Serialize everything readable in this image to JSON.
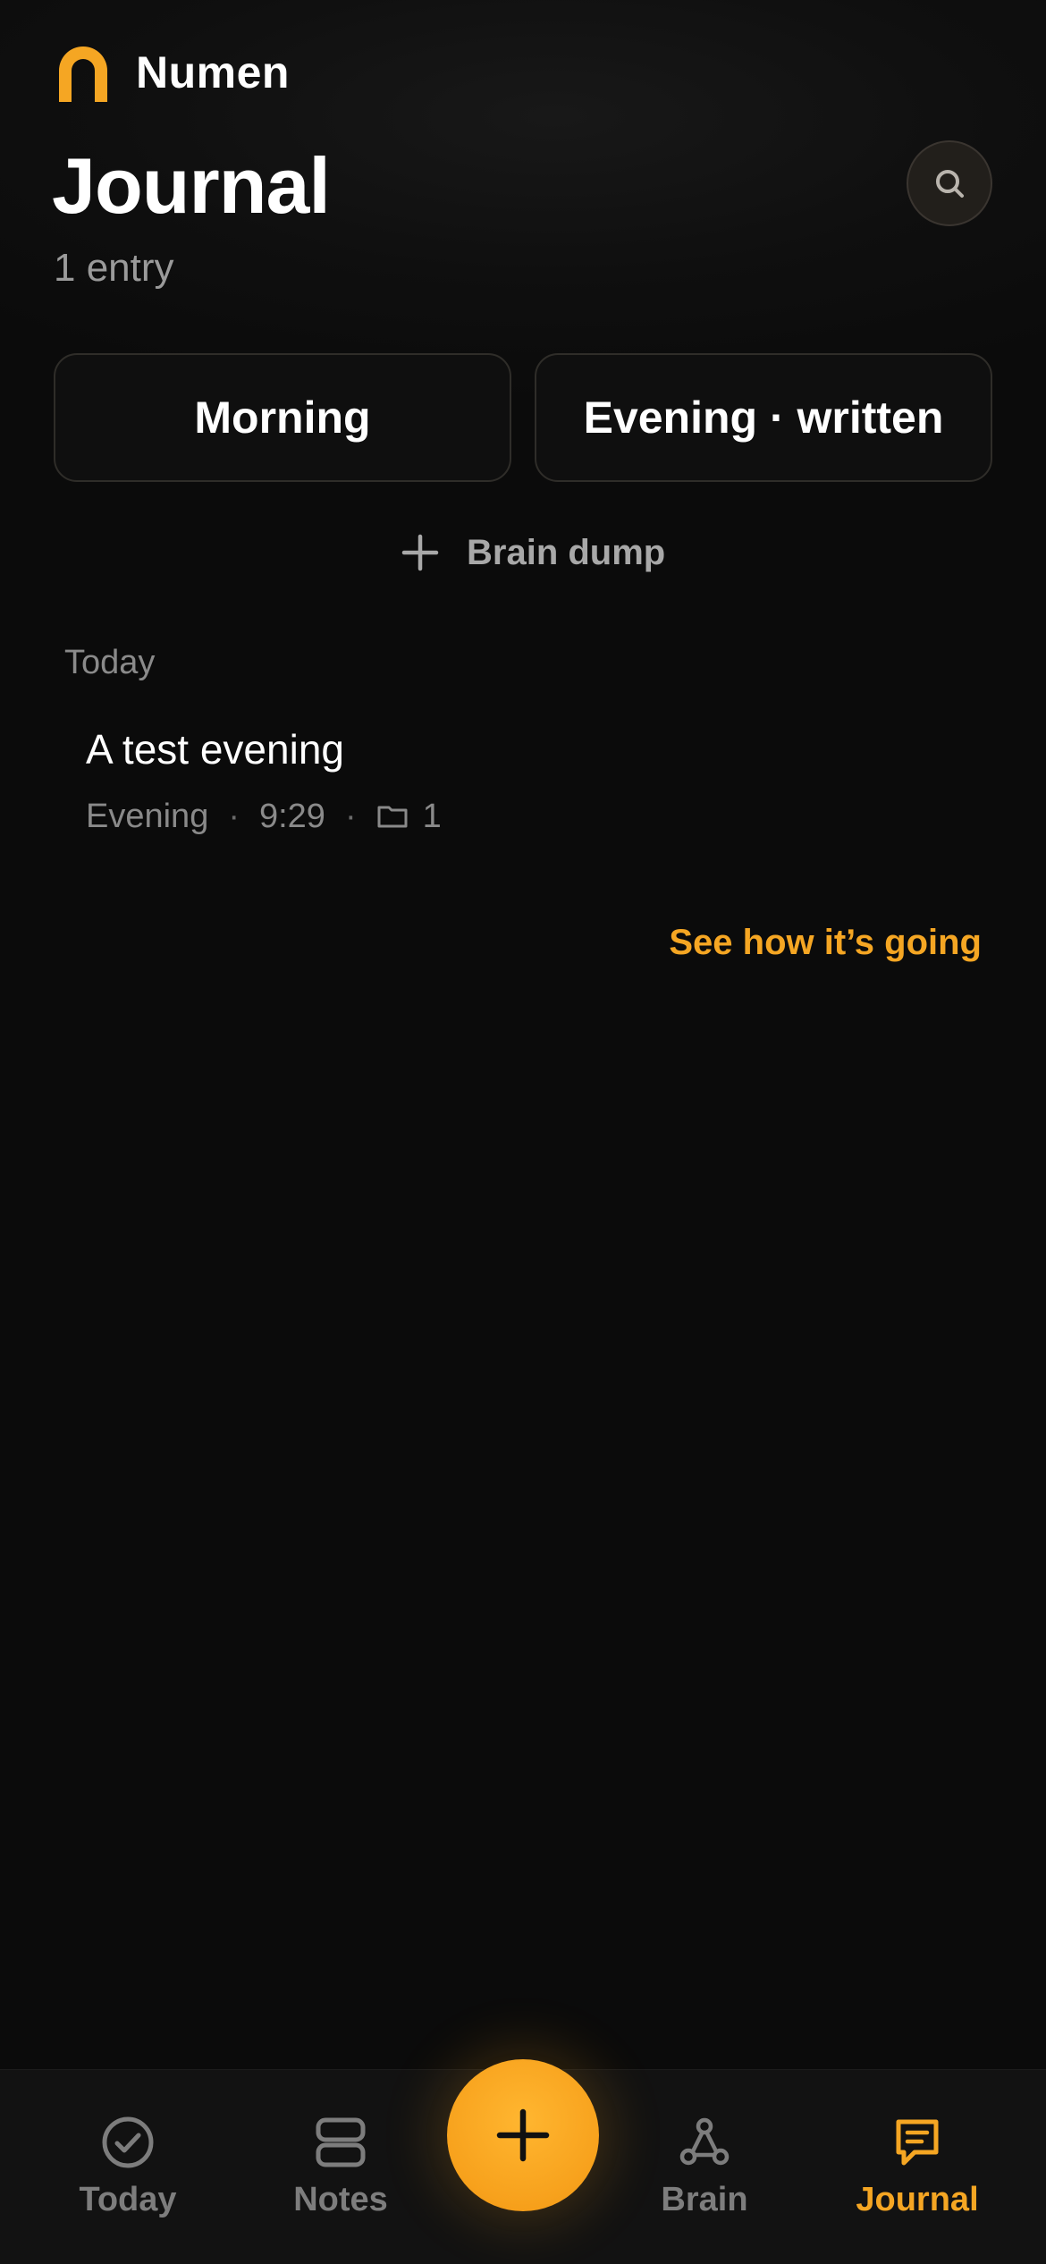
{
  "app": {
    "name": "Numen",
    "accent_color": "#f5a623",
    "logo_icon": "arch-logo-icon"
  },
  "header": {
    "title": "Journal",
    "entry_count": "1 entry",
    "search_icon": "search-icon"
  },
  "modes": {
    "morning_label": "Morning",
    "evening_label": "Evening · written"
  },
  "brain_dump": {
    "label": "Brain dump",
    "icon": "plus-icon"
  },
  "entries": {
    "section_label": "Today",
    "items": [
      {
        "title": "A test evening",
        "type": "Evening",
        "time": "9:29",
        "folder_icon": "folder-icon",
        "folder_count": "1"
      }
    ]
  },
  "progress_link": {
    "label": "See how it’s going"
  },
  "tabbar": {
    "tabs": [
      {
        "label": "Today",
        "icon": "check-circle-icon",
        "active": false
      },
      {
        "label": "Notes",
        "icon": "stack-icon",
        "active": false
      },
      {
        "label": "Brain",
        "icon": "graph-icon",
        "active": false
      },
      {
        "label": "Journal",
        "icon": "journal-icon",
        "active": true
      }
    ],
    "fab_icon": "plus-icon"
  }
}
